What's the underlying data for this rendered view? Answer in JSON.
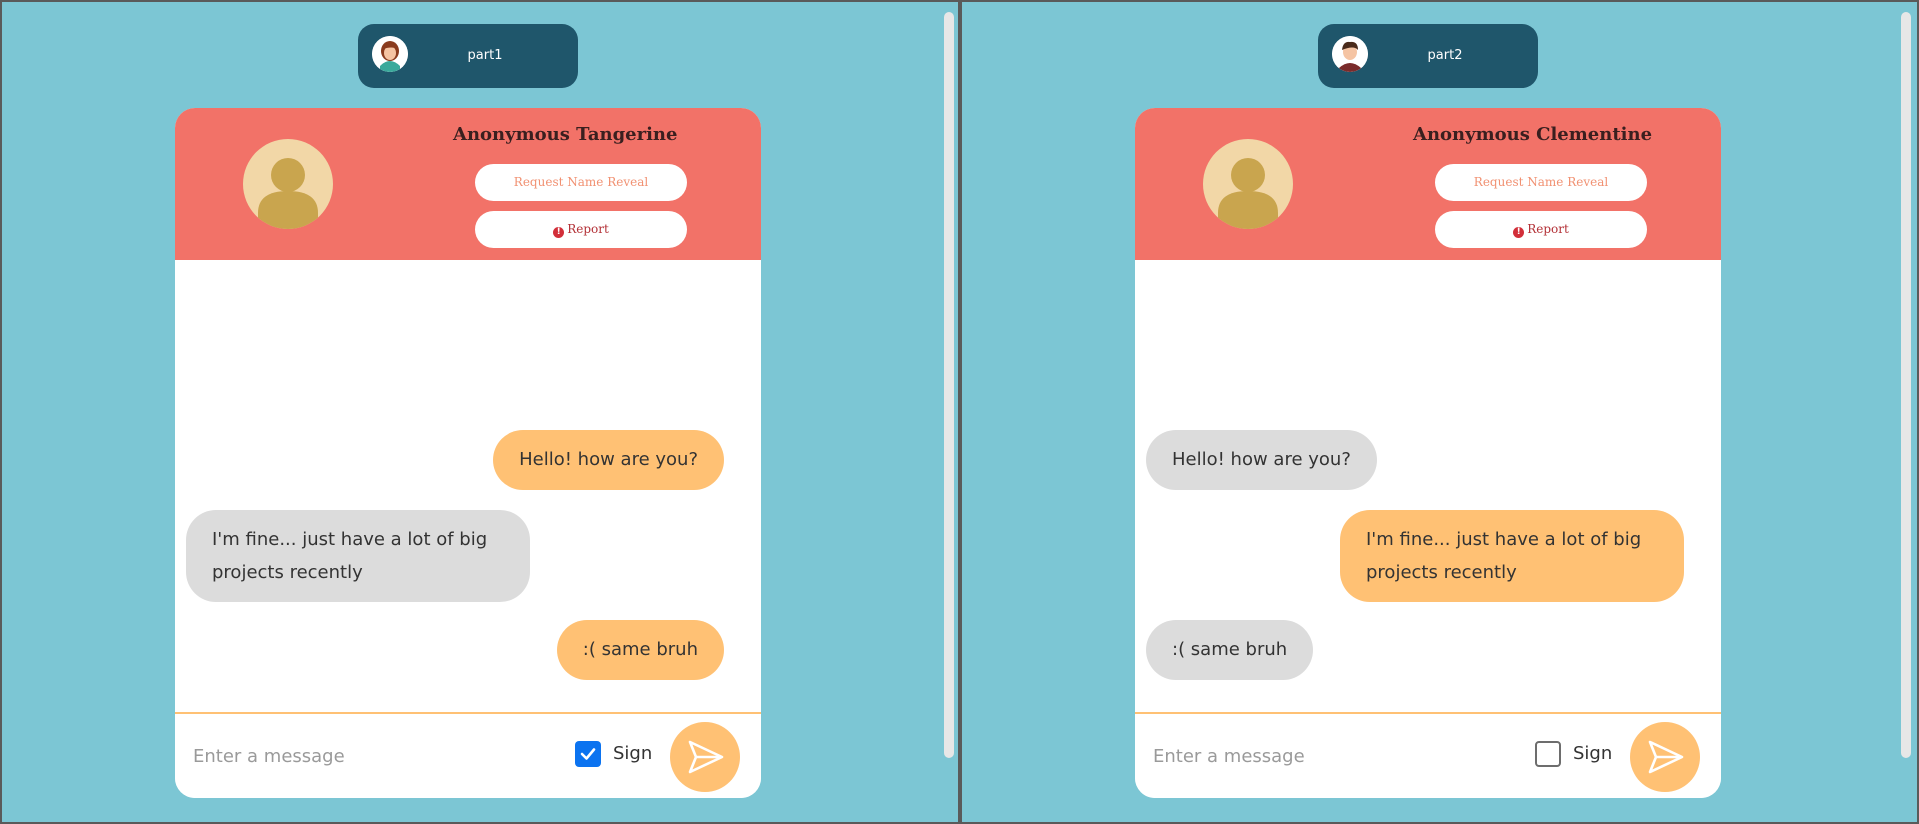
{
  "left": {
    "user_label": "part1",
    "peer_name": "Anonymous Tangerine",
    "reveal_label": "Request Name Reveal",
    "report_label": "Report",
    "messages": [
      {
        "text": "Hello! how are you?",
        "from": "me"
      },
      {
        "text": "I'm fine... just have a lot of big projects recently",
        "from": "peer"
      },
      {
        "text": ":( same bruh",
        "from": "me"
      }
    ],
    "input_placeholder": "Enter a message",
    "input_value": "",
    "sign_label": "Sign",
    "sign_checked": true
  },
  "right": {
    "user_label": "part2",
    "peer_name": "Anonymous Clementine",
    "reveal_label": "Request Name Reveal",
    "report_label": "Report",
    "messages": [
      {
        "text": "Hello! how are you?",
        "from": "peer"
      },
      {
        "text": "I'm fine... just have a lot of big projects recently",
        "from": "me"
      },
      {
        "text": ":( same bruh",
        "from": "peer"
      }
    ],
    "input_placeholder": "Enter a message",
    "input_value": "",
    "sign_label": "Sign",
    "sign_checked": false
  },
  "icons": {
    "user_avatar_left": "female-avatar-icon",
    "user_avatar_right": "male-avatar-icon",
    "peer_avatar": "person-placeholder-icon",
    "report": "exclamation-circle-icon",
    "send": "paper-plane-icon"
  },
  "colors": {
    "background": "#7cc6d4",
    "user_pill": "#1f566b",
    "header": "#f27268",
    "my_bubble": "#ffc174",
    "peer_bubble": "#dcdcdc",
    "send_button": "#ffc174",
    "checkbox_checked": "#0b73f0"
  }
}
